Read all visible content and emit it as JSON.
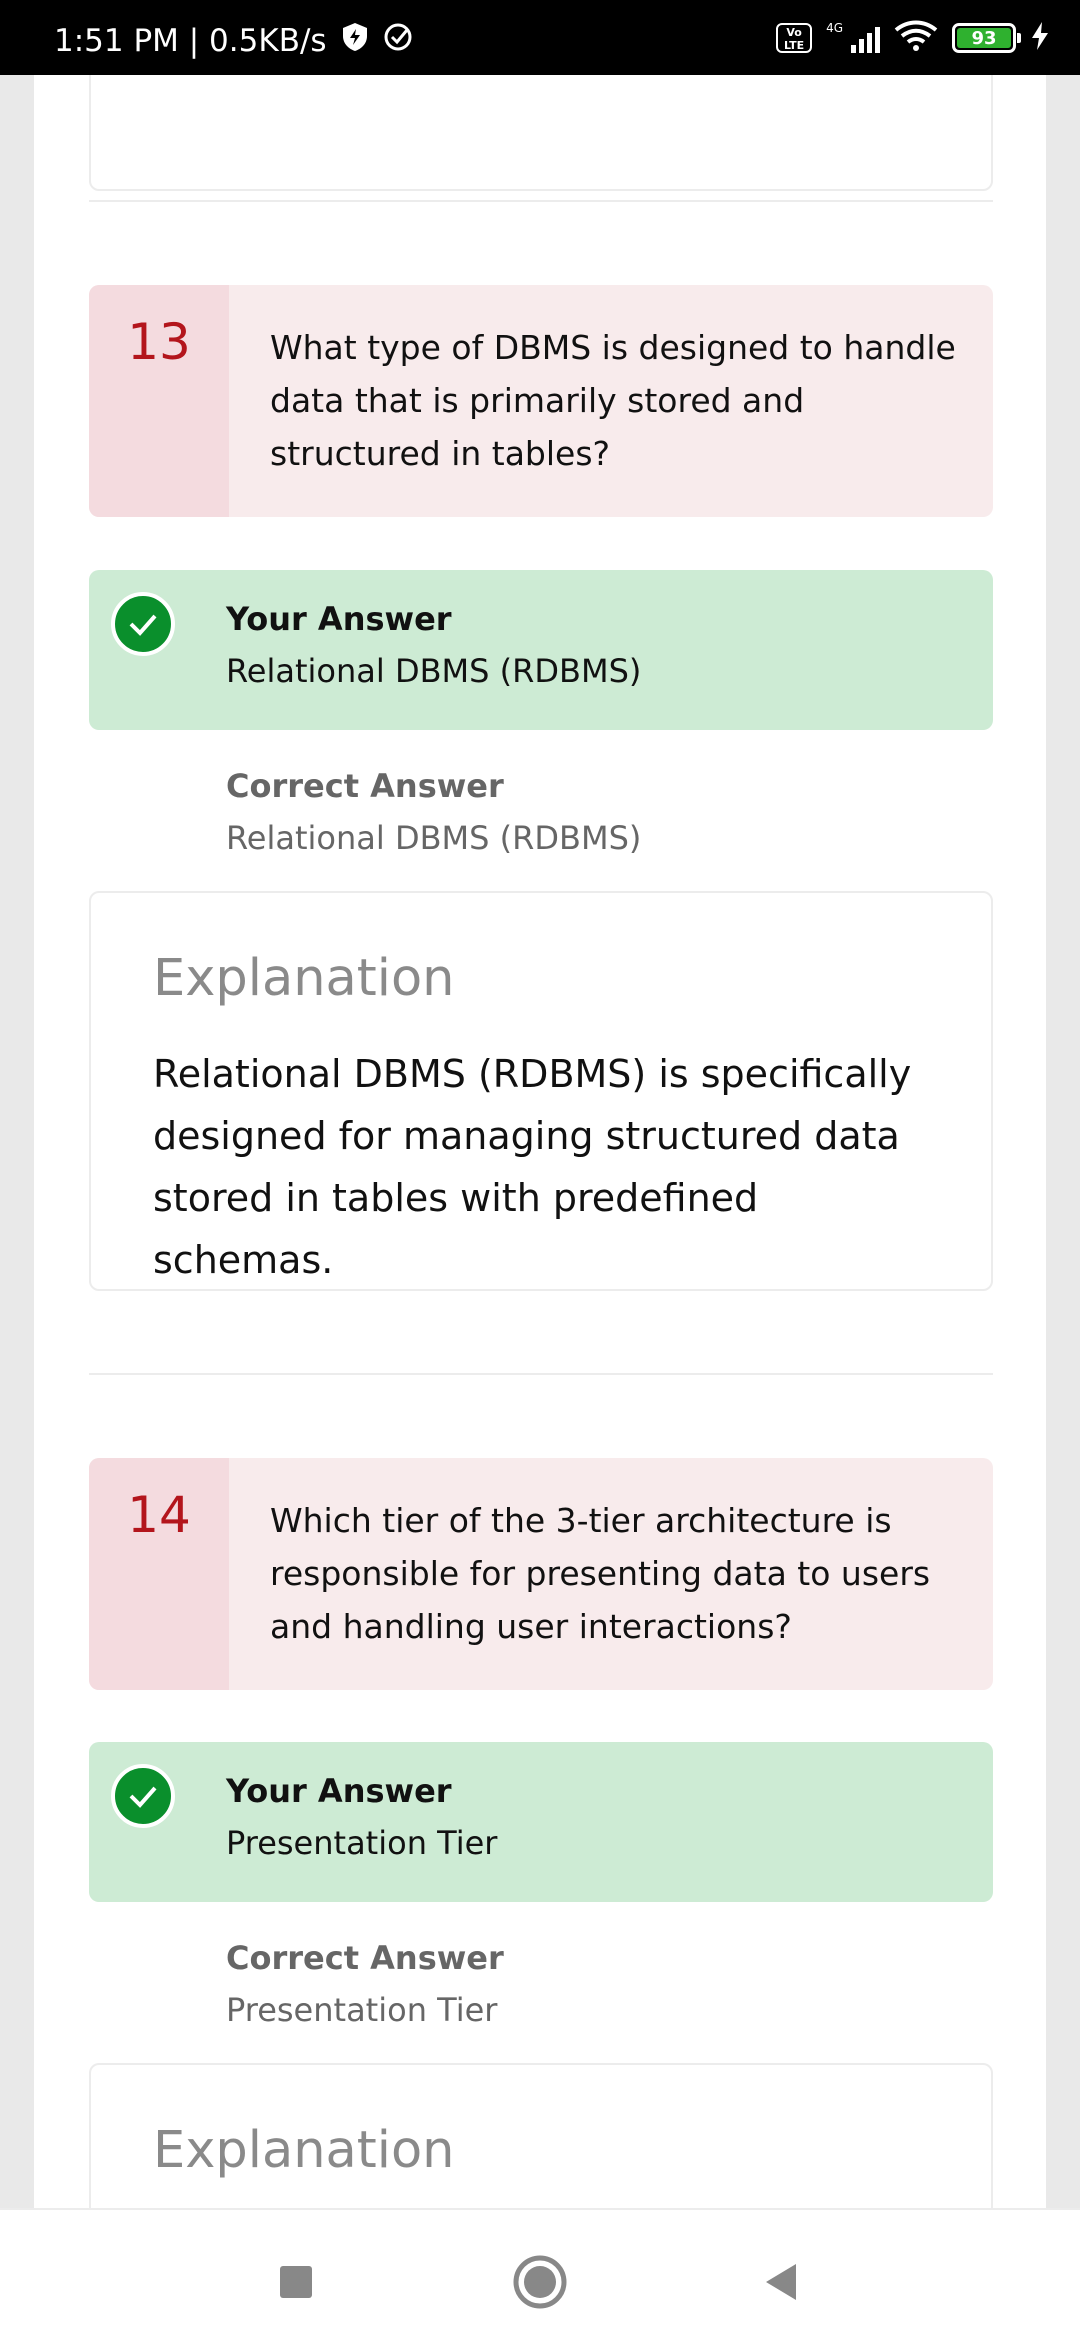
{
  "status_bar": {
    "time_speed": "1:51 PM | 0.5KB/s",
    "network": "4G",
    "volte": "Vo LTE",
    "battery": "93"
  },
  "questions": [
    {
      "number": "13",
      "text": "What type of DBMS is designed to handle data that is primarily stored and structured in tables?",
      "your_answer_label": "Your Answer",
      "your_answer": "Relational DBMS (RDBMS)",
      "correct_answer_label": "Correct Answer",
      "correct_answer": "Relational DBMS (RDBMS)",
      "explanation_title": "Explanation",
      "explanation": "Relational DBMS (RDBMS) is specifically designed for managing structured data stored in tables with predefined schemas."
    },
    {
      "number": "14",
      "text": "Which tier of the 3-tier architecture is responsible for presenting data to users and handling user interactions?",
      "your_answer_label": "Your Answer",
      "your_answer": "Presentation Tier",
      "correct_answer_label": "Correct Answer",
      "correct_answer": "Presentation Tier",
      "explanation_title": "Explanation"
    }
  ],
  "colors": {
    "question_bg": "#f8ebec",
    "question_number": "#b3151c",
    "answer_bg": "#cdebd4",
    "check": "#0a8f2c"
  }
}
